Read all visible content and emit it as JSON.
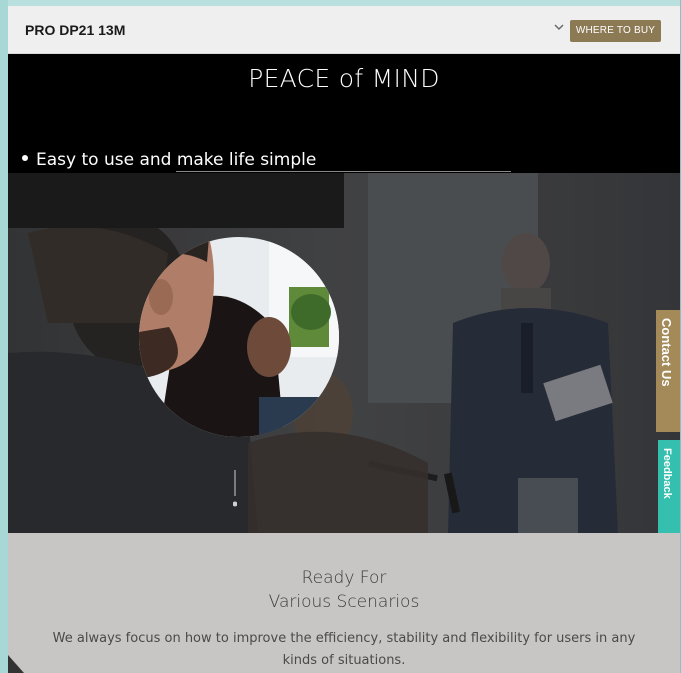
{
  "header": {
    "product_name": "PRO DP21 13M",
    "where_to_buy_label": "WHERE TO BUY"
  },
  "hero": {
    "title": "PEACE of MIND",
    "bullet": "Easy to use and make life simple"
  },
  "side_tabs": {
    "contact": "Contact Us",
    "feedback": "Feedback"
  },
  "section": {
    "heading_line1": "Ready For",
    "heading_line2": "Various Scenarios",
    "description": "We always focus on how to improve the efficiency, stability and flexibility for users in any kinds of situations."
  },
  "colors": {
    "accent_gold": "#8c7a55",
    "contact_tab": "#a48a58",
    "feedback_tab": "#34bfae",
    "section_bg": "#c7c6c4"
  },
  "icons": {
    "dropdown": "chevron-down-icon"
  }
}
